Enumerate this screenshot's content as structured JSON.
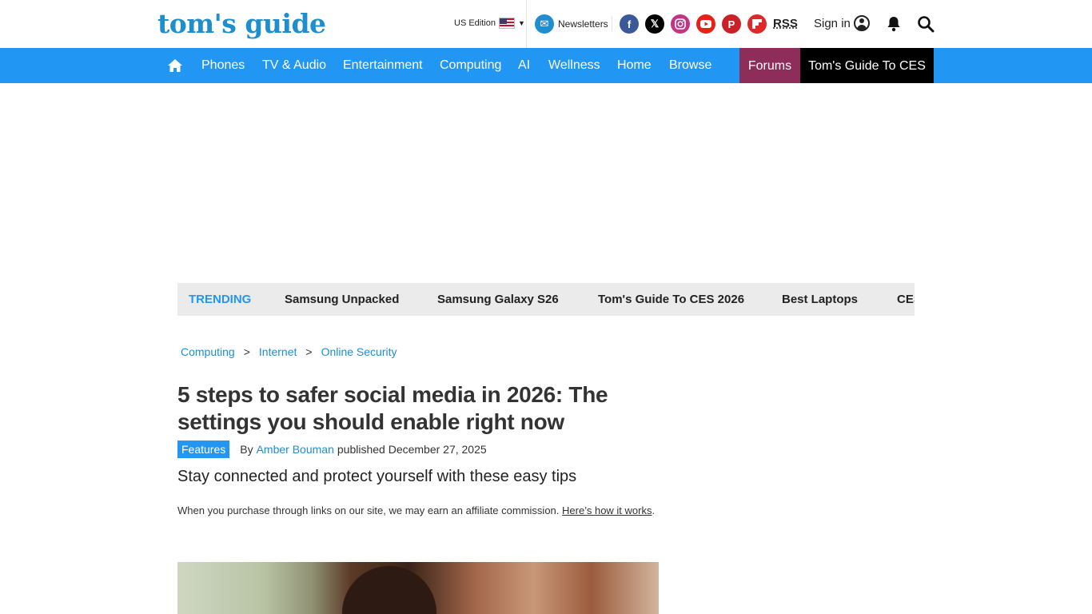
{
  "header": {
    "logo": "tom's guide",
    "edition": "US Edition",
    "newsletters": "Newsletters",
    "rss": "RSS",
    "signin": "Sign in",
    "socials": [
      {
        "name": "facebook",
        "glyph": "f",
        "color": "#3b5998"
      },
      {
        "name": "x",
        "glyph": "𝕏",
        "color": "#000000"
      },
      {
        "name": "instagram",
        "glyph": "◎",
        "color": "#c13584"
      },
      {
        "name": "youtube",
        "glyph": "▶",
        "color": "#e62117"
      },
      {
        "name": "pinterest",
        "glyph": "P",
        "color": "#cb2027"
      },
      {
        "name": "flipboard",
        "glyph": "f",
        "color": "#e12828"
      }
    ]
  },
  "nav": {
    "items": [
      "Phones",
      "TV & Audio",
      "Entertainment",
      "Computing",
      "AI",
      "Wellness",
      "Home",
      "Browse"
    ],
    "forums": "Forums",
    "ces": "Tom's Guide To CES",
    "accent": "#2196f3"
  },
  "trending": {
    "label": "TRENDING",
    "items": [
      "Samsung Unpacked",
      "Samsung Galaxy S26",
      "Tom's Guide To CES 2026",
      "Best Laptops",
      "CES"
    ]
  },
  "breadcrumb": [
    "Computing",
    "Internet",
    "Online Security"
  ],
  "article": {
    "headline": "5 steps to safer social media in 2026: The settings you should enable right now",
    "badge": "Features",
    "by": "By",
    "author": "Amber Bouman",
    "published": "published December 27, 2025",
    "strap": "Stay connected and protect yourself with these easy tips",
    "affiliate_text": "When you purchase through links on our site, we may earn an affiliate commission.",
    "affiliate_link": "Here’s how it works",
    "affiliate_end": "."
  }
}
